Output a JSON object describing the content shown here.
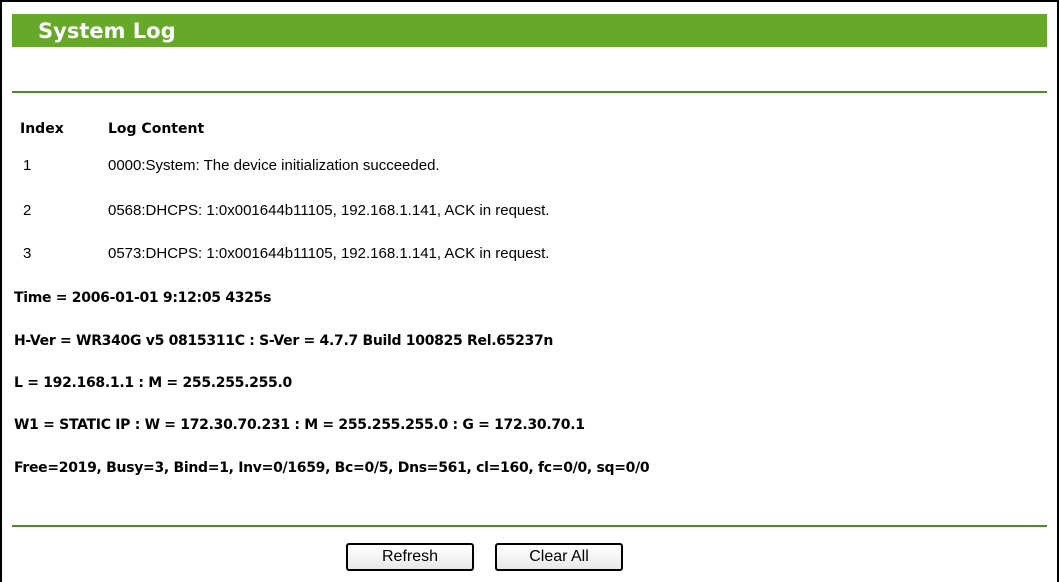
{
  "page": {
    "title": "System Log"
  },
  "table": {
    "headers": {
      "index": "Index",
      "content": "Log Content"
    },
    "rows": [
      {
        "index": "1",
        "content": "0000:System: The device initialization succeeded."
      },
      {
        "index": "2",
        "content": "0568:DHCPS: 1:0x001644b11105, 192.168.1.141, ACK in request."
      },
      {
        "index": "3",
        "content": "0573:DHCPS: 1:0x001644b11105, 192.168.1.141, ACK in request."
      }
    ]
  },
  "status": {
    "time": "Time = 2006-01-01 9:12:05 4325s",
    "version": "H-Ver = WR340G v5 0815311C : S-Ver = 4.7.7 Build 100825 Rel.65237n",
    "lan": "L = 192.168.1.1 : M = 255.255.255.0",
    "wan": "W1 = STATIC IP : W = 172.30.70.231 : M = 255.255.255.0 : G = 172.30.70.1",
    "stats": "Free=2019, Busy=3, Bind=1, Inv=0/1659, Bc=0/5, Dns=561, cl=160, fc=0/0, sq=0/0"
  },
  "buttons": {
    "refresh": "Refresh",
    "clear_all": "Clear All"
  },
  "colors": {
    "title_bar": "#66a928",
    "rule": "#4f8a2a"
  }
}
